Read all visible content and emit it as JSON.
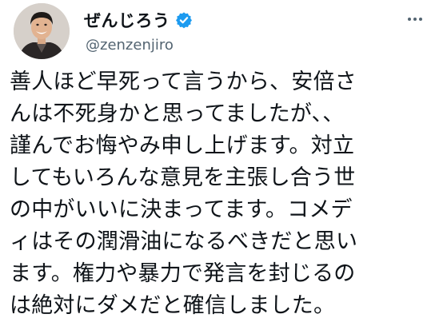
{
  "user": {
    "display_name": "ぜんじろう",
    "handle": "@zenzenjiro",
    "verified": true,
    "avatar_icon": "person-portrait"
  },
  "more_icon": "more-horizontal-icon",
  "colors": {
    "verified_badge": "#1d9bf0",
    "text": "#0f1419",
    "secondary_text": "#536471",
    "background": "#ffffff"
  },
  "tweet": {
    "lines": [
      "善人ほど早死って言うから、安倍さ",
      "んは不死身かと思ってましたが、、",
      "謹んでお悔やみ申し上げます。対立",
      "してもいろんな意見を主張し合う世",
      "の中がいいに決まってます。コメデ",
      "ィはその潤滑油になるべきだと思い",
      "ます。権力や暴力で発言を封じるの",
      "は絶対にダメだと確信しました。"
    ]
  }
}
